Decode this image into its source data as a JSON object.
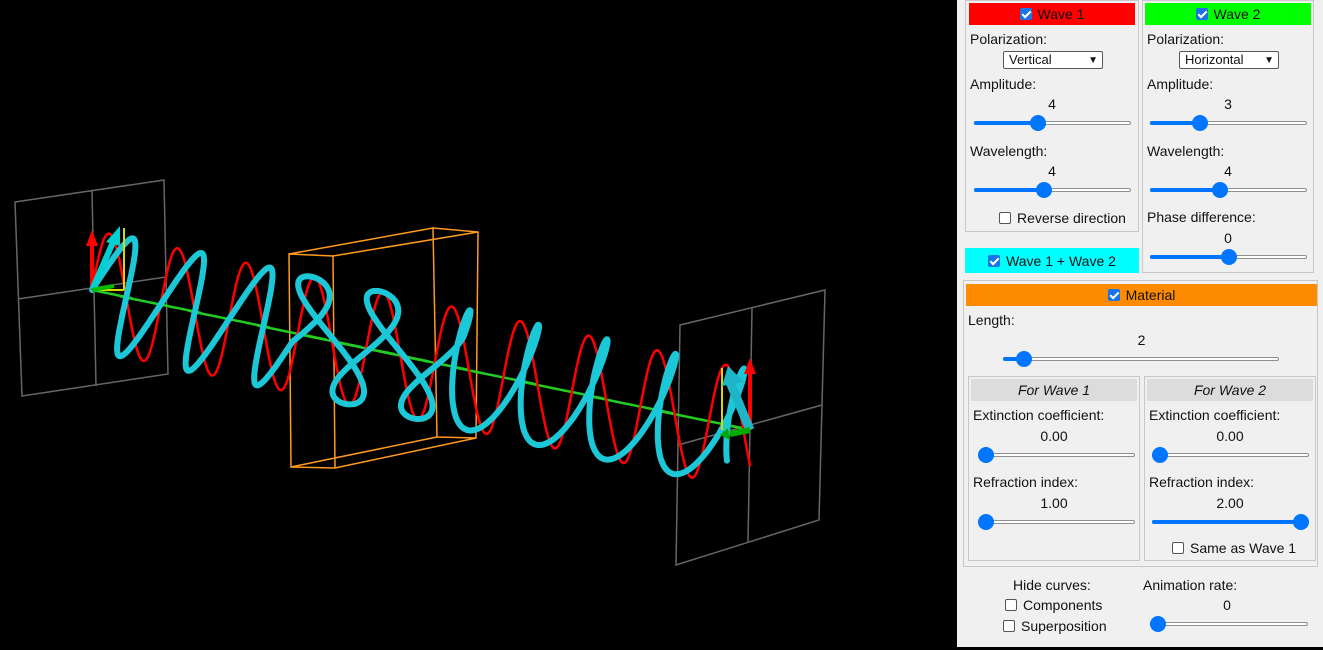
{
  "wave1": {
    "title": "Wave 1",
    "enabled": true,
    "color": "#ff0000",
    "polarization_label": "Polarization:",
    "polarization": "Vertical",
    "amplitude_label": "Amplitude:",
    "amplitude": "4",
    "amplitude_level": 0.4,
    "wavelength_label": "Wavelength:",
    "wavelength": "4",
    "wavelength_level": 0.44,
    "reverse_label": "Reverse direction",
    "reverse": false
  },
  "wave2": {
    "title": "Wave 2",
    "enabled": true,
    "color": "#00ff00",
    "polarization_label": "Polarization:",
    "polarization": "Horizontal",
    "amplitude_label": "Amplitude:",
    "amplitude": "3",
    "amplitude_level": 0.3,
    "wavelength_label": "Wavelength:",
    "wavelength": "4",
    "wavelength_level": 0.44,
    "phase_label": "Phase difference:",
    "phase": "0",
    "phase_level": 0.5
  },
  "sum": {
    "title": "Wave 1 + Wave 2",
    "enabled": true,
    "color": "#00ffff"
  },
  "material": {
    "title": "Material",
    "enabled": true,
    "color": "#ff8c00",
    "length_label": "Length:",
    "length": "2",
    "length_level": 0.05,
    "for_wave1": {
      "title": "For Wave 1",
      "extinction_label": "Extinction coefficient:",
      "extinction": "0.00",
      "extinction_level": 0.0,
      "refraction_label": "Refraction index:",
      "refraction": "1.00",
      "refraction_level": 0.0
    },
    "for_wave2": {
      "title": "For Wave 2",
      "extinction_label": "Extinction coefficient:",
      "extinction": "0.00",
      "extinction_level": 0.0,
      "refraction_label": "Refraction index:",
      "refraction": "2.00",
      "refraction_level": 1.0,
      "same_label": "Same as Wave 1",
      "same": false
    }
  },
  "hide": {
    "title": "Hide curves:",
    "components_label": "Components",
    "components": false,
    "superposition_label": "Superposition",
    "superposition": false
  },
  "animation": {
    "label": "Animation rate:",
    "value": "0",
    "level": 0.0
  }
}
